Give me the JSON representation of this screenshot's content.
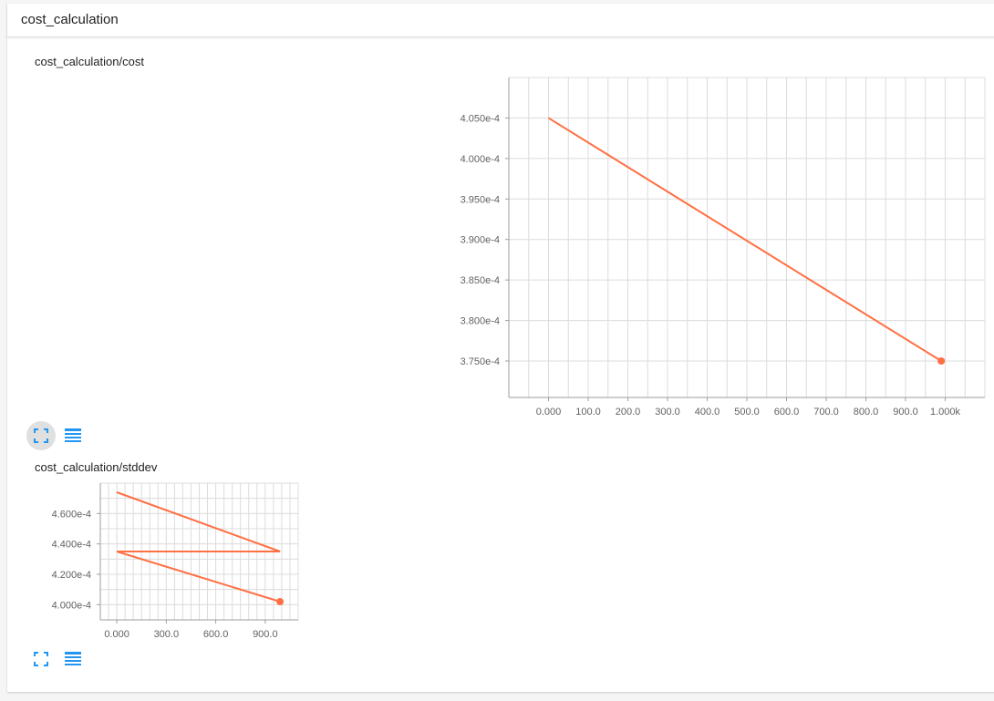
{
  "card": {
    "title": "cost_calculation"
  },
  "colors": {
    "series": "#ff7043",
    "grid": "#dcdcdc",
    "icon": "#2196f3",
    "axis": "#9e9e9e"
  },
  "icons": {
    "expand": "fit-to-screen-icon",
    "data_toggle": "list-icon"
  },
  "chart_data": [
    {
      "type": "line",
      "title": "cost_calculation/cost",
      "x_ticks": [
        "0.000",
        "100.0",
        "200.0",
        "300.0",
        "400.0",
        "500.0",
        "600.0",
        "700.0",
        "800.0",
        "900.0",
        "1.000k"
      ],
      "y_ticks": [
        "3.750e-4",
        "3.800e-4",
        "3.850e-4",
        "3.900e-4",
        "3.950e-4",
        "4.000e-4",
        "4.050e-4"
      ],
      "xlim": [
        -100,
        1100
      ],
      "ylim": [
        0.0003705,
        0.00041
      ],
      "grid": true,
      "series": [
        {
          "x": [
            0,
            990
          ],
          "y": [
            0.000405,
            0.000375
          ]
        }
      ]
    },
    {
      "type": "line",
      "title": "cost_calculation/stddev",
      "x_ticks": [
        "0.000",
        "300.0",
        "600.0",
        "900.0"
      ],
      "y_ticks": [
        "4.000e-4",
        "4.200e-4",
        "4.400e-4",
        "4.600e-4"
      ],
      "xlim": [
        -100,
        1100
      ],
      "ylim": [
        0.00039,
        0.00048
      ],
      "grid": true,
      "series": [
        {
          "x": [
            0,
            990
          ],
          "y": [
            0.000474,
            0.000435
          ]
        },
        {
          "x": [
            0,
            990
          ],
          "y": [
            0.000435,
            0.000435
          ]
        },
        {
          "x": [
            0,
            990
          ],
          "y": [
            0.000435,
            0.000402
          ]
        }
      ]
    }
  ]
}
